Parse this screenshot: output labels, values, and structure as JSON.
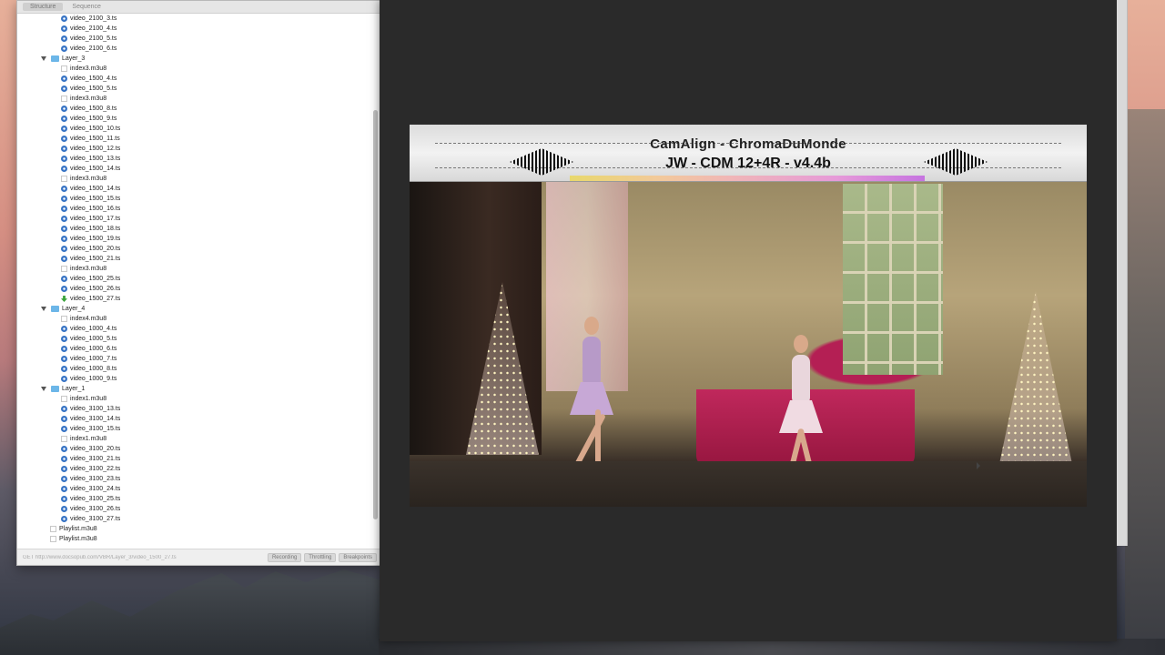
{
  "charles": {
    "tabs": [
      {
        "label": "Structure",
        "active": true
      },
      {
        "label": "Sequence",
        "active": false
      }
    ],
    "tree": [
      {
        "type": "ts",
        "label": "video_2100_3.ts",
        "indent": 48
      },
      {
        "type": "ts",
        "label": "video_2100_4.ts",
        "indent": 48
      },
      {
        "type": "ts",
        "label": "video_2100_5.ts",
        "indent": 48
      },
      {
        "type": "ts",
        "label": "video_2100_6.ts",
        "indent": 48
      },
      {
        "type": "folder",
        "label": "Layer_3",
        "indent": 26
      },
      {
        "type": "file",
        "label": "index3.m3u8",
        "indent": 48
      },
      {
        "type": "ts",
        "label": "video_1500_4.ts",
        "indent": 48
      },
      {
        "type": "ts",
        "label": "video_1500_5.ts",
        "indent": 48
      },
      {
        "type": "file",
        "label": "index3.m3u8",
        "indent": 48
      },
      {
        "type": "ts",
        "label": "video_1500_8.ts",
        "indent": 48
      },
      {
        "type": "ts",
        "label": "video_1500_9.ts",
        "indent": 48
      },
      {
        "type": "ts",
        "label": "video_1500_10.ts",
        "indent": 48
      },
      {
        "type": "ts",
        "label": "video_1500_11.ts",
        "indent": 48
      },
      {
        "type": "ts",
        "label": "video_1500_12.ts",
        "indent": 48
      },
      {
        "type": "ts",
        "label": "video_1500_13.ts",
        "indent": 48
      },
      {
        "type": "ts",
        "label": "video_1500_14.ts",
        "indent": 48
      },
      {
        "type": "file",
        "label": "index3.m3u8",
        "indent": 48
      },
      {
        "type": "ts",
        "label": "video_1500_14.ts",
        "indent": 48
      },
      {
        "type": "ts",
        "label": "video_1500_15.ts",
        "indent": 48
      },
      {
        "type": "ts",
        "label": "video_1500_16.ts",
        "indent": 48
      },
      {
        "type": "ts",
        "label": "video_1500_17.ts",
        "indent": 48
      },
      {
        "type": "ts",
        "label": "video_1500_18.ts",
        "indent": 48
      },
      {
        "type": "ts",
        "label": "video_1500_19.ts",
        "indent": 48
      },
      {
        "type": "ts",
        "label": "video_1500_20.ts",
        "indent": 48
      },
      {
        "type": "ts",
        "label": "video_1500_21.ts",
        "indent": 48
      },
      {
        "type": "file",
        "label": "index3.m3u8",
        "indent": 48
      },
      {
        "type": "ts",
        "label": "video_1500_25.ts",
        "indent": 48
      },
      {
        "type": "ts",
        "label": "video_1500_26.ts",
        "indent": 48
      },
      {
        "type": "download",
        "label": "video_1500_27.ts",
        "indent": 48
      },
      {
        "type": "folder",
        "label": "Layer_4",
        "indent": 26
      },
      {
        "type": "file",
        "label": "index4.m3u8",
        "indent": 48
      },
      {
        "type": "ts",
        "label": "video_1000_4.ts",
        "indent": 48
      },
      {
        "type": "ts",
        "label": "video_1000_5.ts",
        "indent": 48
      },
      {
        "type": "ts",
        "label": "video_1000_6.ts",
        "indent": 48
      },
      {
        "type": "ts",
        "label": "video_1000_7.ts",
        "indent": 48
      },
      {
        "type": "ts",
        "label": "video_1000_8.ts",
        "indent": 48
      },
      {
        "type": "ts",
        "label": "video_1000_9.ts",
        "indent": 48
      },
      {
        "type": "folder",
        "label": "Layer_1",
        "indent": 26
      },
      {
        "type": "file",
        "label": "index1.m3u8",
        "indent": 48
      },
      {
        "type": "ts",
        "label": "video_3100_13.ts",
        "indent": 48
      },
      {
        "type": "ts",
        "label": "video_3100_14.ts",
        "indent": 48
      },
      {
        "type": "ts",
        "label": "video_3100_15.ts",
        "indent": 48
      },
      {
        "type": "file",
        "label": "index1.m3u8",
        "indent": 48
      },
      {
        "type": "ts",
        "label": "video_3100_20.ts",
        "indent": 48
      },
      {
        "type": "ts",
        "label": "video_3100_21.ts",
        "indent": 48
      },
      {
        "type": "ts",
        "label": "video_3100_22.ts",
        "indent": 48
      },
      {
        "type": "ts",
        "label": "video_3100_23.ts",
        "indent": 48
      },
      {
        "type": "ts",
        "label": "video_3100_24.ts",
        "indent": 48
      },
      {
        "type": "ts",
        "label": "video_3100_25.ts",
        "indent": 48
      },
      {
        "type": "ts",
        "label": "video_3100_26.ts",
        "indent": 48
      },
      {
        "type": "ts",
        "label": "video_3100_27.ts",
        "indent": 48
      },
      {
        "type": "file",
        "label": "Playlist.m3u8",
        "indent": 36
      },
      {
        "type": "file",
        "label": "Playlist.m3u8",
        "indent": 36
      }
    ],
    "status": {
      "text": "GET http://www.docsopub.com/VBR/Layer_3/video_1500_27.ts",
      "buttons": [
        "Recording",
        "Throttling",
        "Breakpoints"
      ]
    }
  },
  "video": {
    "chart_title": "CamAlign - ChromaDuMonde",
    "chart_sub": "JW - CDM 12+4R - v4.4b",
    "icons": [
      "ts-file-icon",
      "m3u8-file-icon",
      "folder-icon",
      "download-icon",
      "mouse-cursor-icon"
    ]
  }
}
